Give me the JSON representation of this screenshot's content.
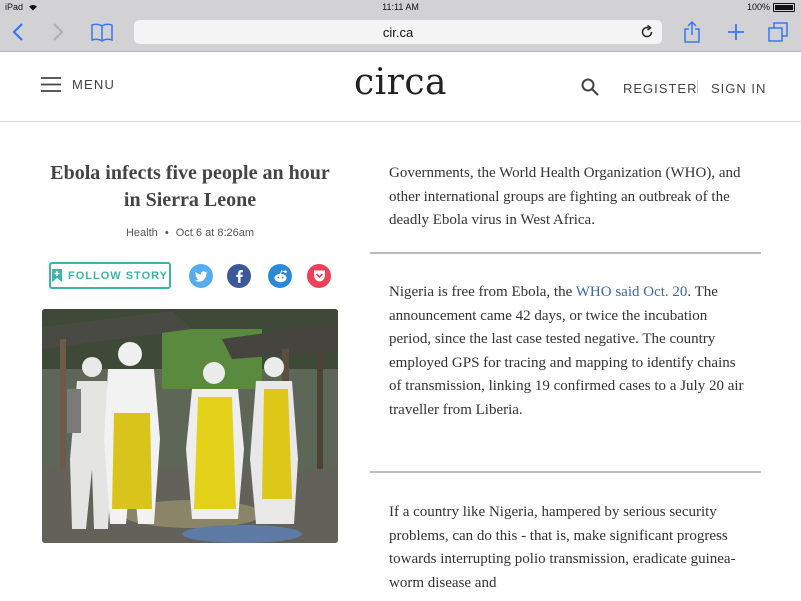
{
  "status_bar": {
    "device": "iPad",
    "time": "11:11 AM",
    "battery": "100%"
  },
  "browser": {
    "url": "cir.ca"
  },
  "site": {
    "menu_label": "MENU",
    "logo": "circa",
    "register_label": "REGISTER",
    "signin_label": "SIGN IN"
  },
  "story": {
    "title": "Ebola infects five people an hour in Sierra Leone",
    "category": "Health",
    "separator": "•",
    "date": "Oct 6 at 8:26am",
    "follow_label": "FOLLOW STORY",
    "social_icons": [
      "twitter-icon",
      "facebook-icon",
      "reddit-icon",
      "pocket-icon"
    ]
  },
  "content": {
    "para1": "Governments, the World Health Organization (WHO), and other international groups are fighting an outbreak of the deadly Ebola virus in West Africa.",
    "para2_before": "Nigeria is free from Ebola, the ",
    "para2_link": "WHO said Oct. 20",
    "para2_after": ". The announcement came 42 days, or twice the incubation period, since the last case tested negative. The country employed GPS for tracing and mapping to identify chains of transmission, linking 19 confirmed cases to a July 20 air traveller from Liberia.",
    "para3": "If a country like Nigeria, hampered by serious security problems, can do this - that is, make significant progress towards interrupting polio transmission, eradicate guinea-worm disease and"
  },
  "colors": {
    "accent": "#3cb5a6",
    "twitter": "#55acee",
    "facebook": "#3b5998",
    "reddit": "#2b8ad7",
    "pocket": "#ee4056",
    "link": "#3a6aa5",
    "ios_blue": "#3478f6"
  }
}
